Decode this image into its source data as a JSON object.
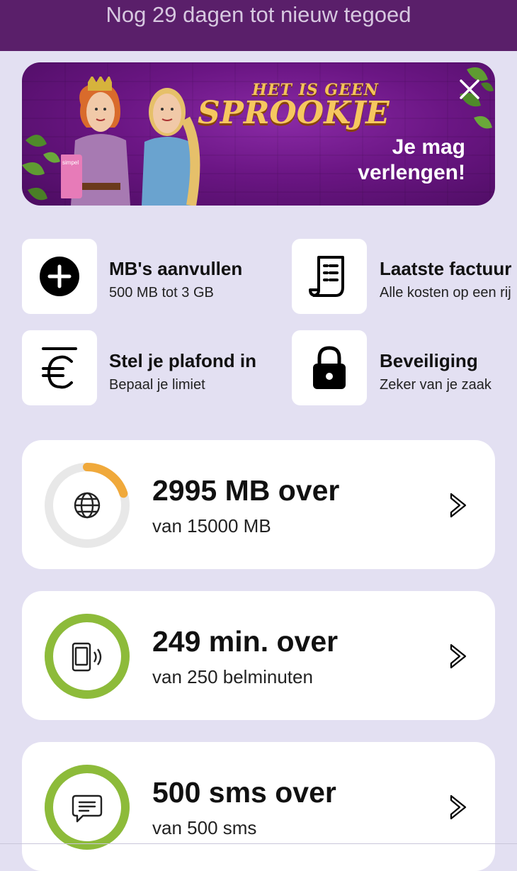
{
  "topbar": {
    "text": "Nog 29 dagen tot nieuw tegoed"
  },
  "banner": {
    "title_small": "HET IS GEEN",
    "title_big": "SPROOKJE",
    "cta_line1": "Je mag",
    "cta_line2": "verlengen!",
    "phone_label": "simpel"
  },
  "actions": [
    {
      "title": "MB's aanvullen",
      "subtitle": "500 MB tot 3 GB",
      "icon": "plus-circle-icon"
    },
    {
      "title": "Laatste factuur",
      "subtitle": "Alle kosten op een rij",
      "icon": "receipt-icon"
    },
    {
      "title": "Stel je plafond in",
      "subtitle": "Bepaal je limiet",
      "icon": "euro-limit-icon"
    },
    {
      "title": "Beveiliging",
      "subtitle": "Zeker van je zaak",
      "icon": "lock-icon"
    }
  ],
  "usage": [
    {
      "big": "2995 MB over",
      "small": "van 15000 MB",
      "icon": "globe-icon",
      "remaining_fraction": 0.2,
      "color": "#f0a93b"
    },
    {
      "big": "249 min. over",
      "small": "van 250 belminuten",
      "icon": "phone-icon",
      "remaining_fraction": 0.996,
      "color": "#8dbb3a"
    },
    {
      "big": "500 sms over",
      "small": "van 500 sms",
      "icon": "message-icon",
      "remaining_fraction": 1.0,
      "color": "#8dbb3a"
    }
  ],
  "colors": {
    "topbar": "#5a1f6a",
    "background": "#e3e0f2",
    "data_ring": "#f0a93b",
    "ok_ring": "#8dbb3a",
    "ring_track": "#e8e8e8"
  }
}
